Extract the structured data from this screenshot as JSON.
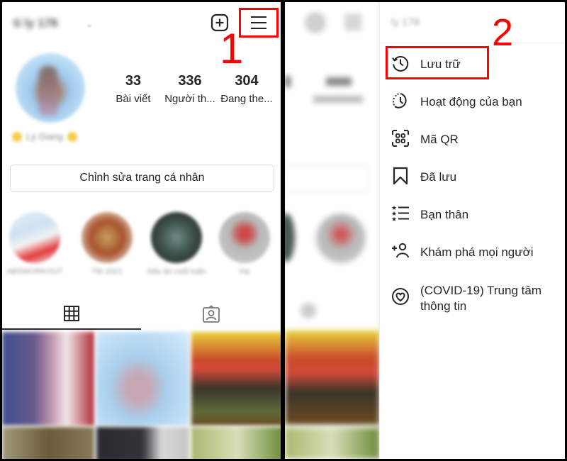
{
  "left_panel": {
    "username": "ti ly 178",
    "add_icon": "plus-square-icon",
    "menu_icon": "hamburger-menu-icon",
    "step_label": "1",
    "stats": [
      {
        "value": "33",
        "label": "Bài viết"
      },
      {
        "value": "336",
        "label": "Người th..."
      },
      {
        "value": "304",
        "label": "Đang the..."
      }
    ],
    "bio": "Lý Giang",
    "edit_profile_label": "Chỉnh sửa trang cá nhân",
    "highlights": [
      {
        "label": "ABSWORKOUT"
      },
      {
        "label": "Tết 2021"
      },
      {
        "label": "Nấu ăn cuối tuần"
      },
      {
        "label": "Hà"
      }
    ],
    "tabs": [
      {
        "name": "grid",
        "icon": "grid-icon",
        "active": true
      },
      {
        "name": "tagged",
        "icon": "tagged-person-icon",
        "active": false
      }
    ]
  },
  "right_panel": {
    "drawer_username": "ly 178",
    "step_label": "2",
    "menu_items": [
      {
        "label": "Lưu trữ",
        "icon": "archive-history-icon",
        "highlighted": true
      },
      {
        "label": "Hoạt động của bạn",
        "icon": "activity-clock-icon",
        "highlighted": false
      },
      {
        "label": "Mã QR",
        "icon": "qr-code-icon",
        "highlighted": false
      },
      {
        "label": "Đã lưu",
        "icon": "bookmark-icon",
        "highlighted": false
      },
      {
        "label": "Bạn thân",
        "icon": "close-friends-list-icon",
        "highlighted": false
      },
      {
        "label": "Khám phá mọi người",
        "icon": "discover-people-icon",
        "highlighted": false
      },
      {
        "label": "(COVID-19) Trung tâm thông tin",
        "icon": "covid-info-heart-icon",
        "highlighted": false
      }
    ]
  },
  "colors": {
    "annotation_red": "#ff0000",
    "text": "#262626",
    "border": "#dbdbdb"
  }
}
